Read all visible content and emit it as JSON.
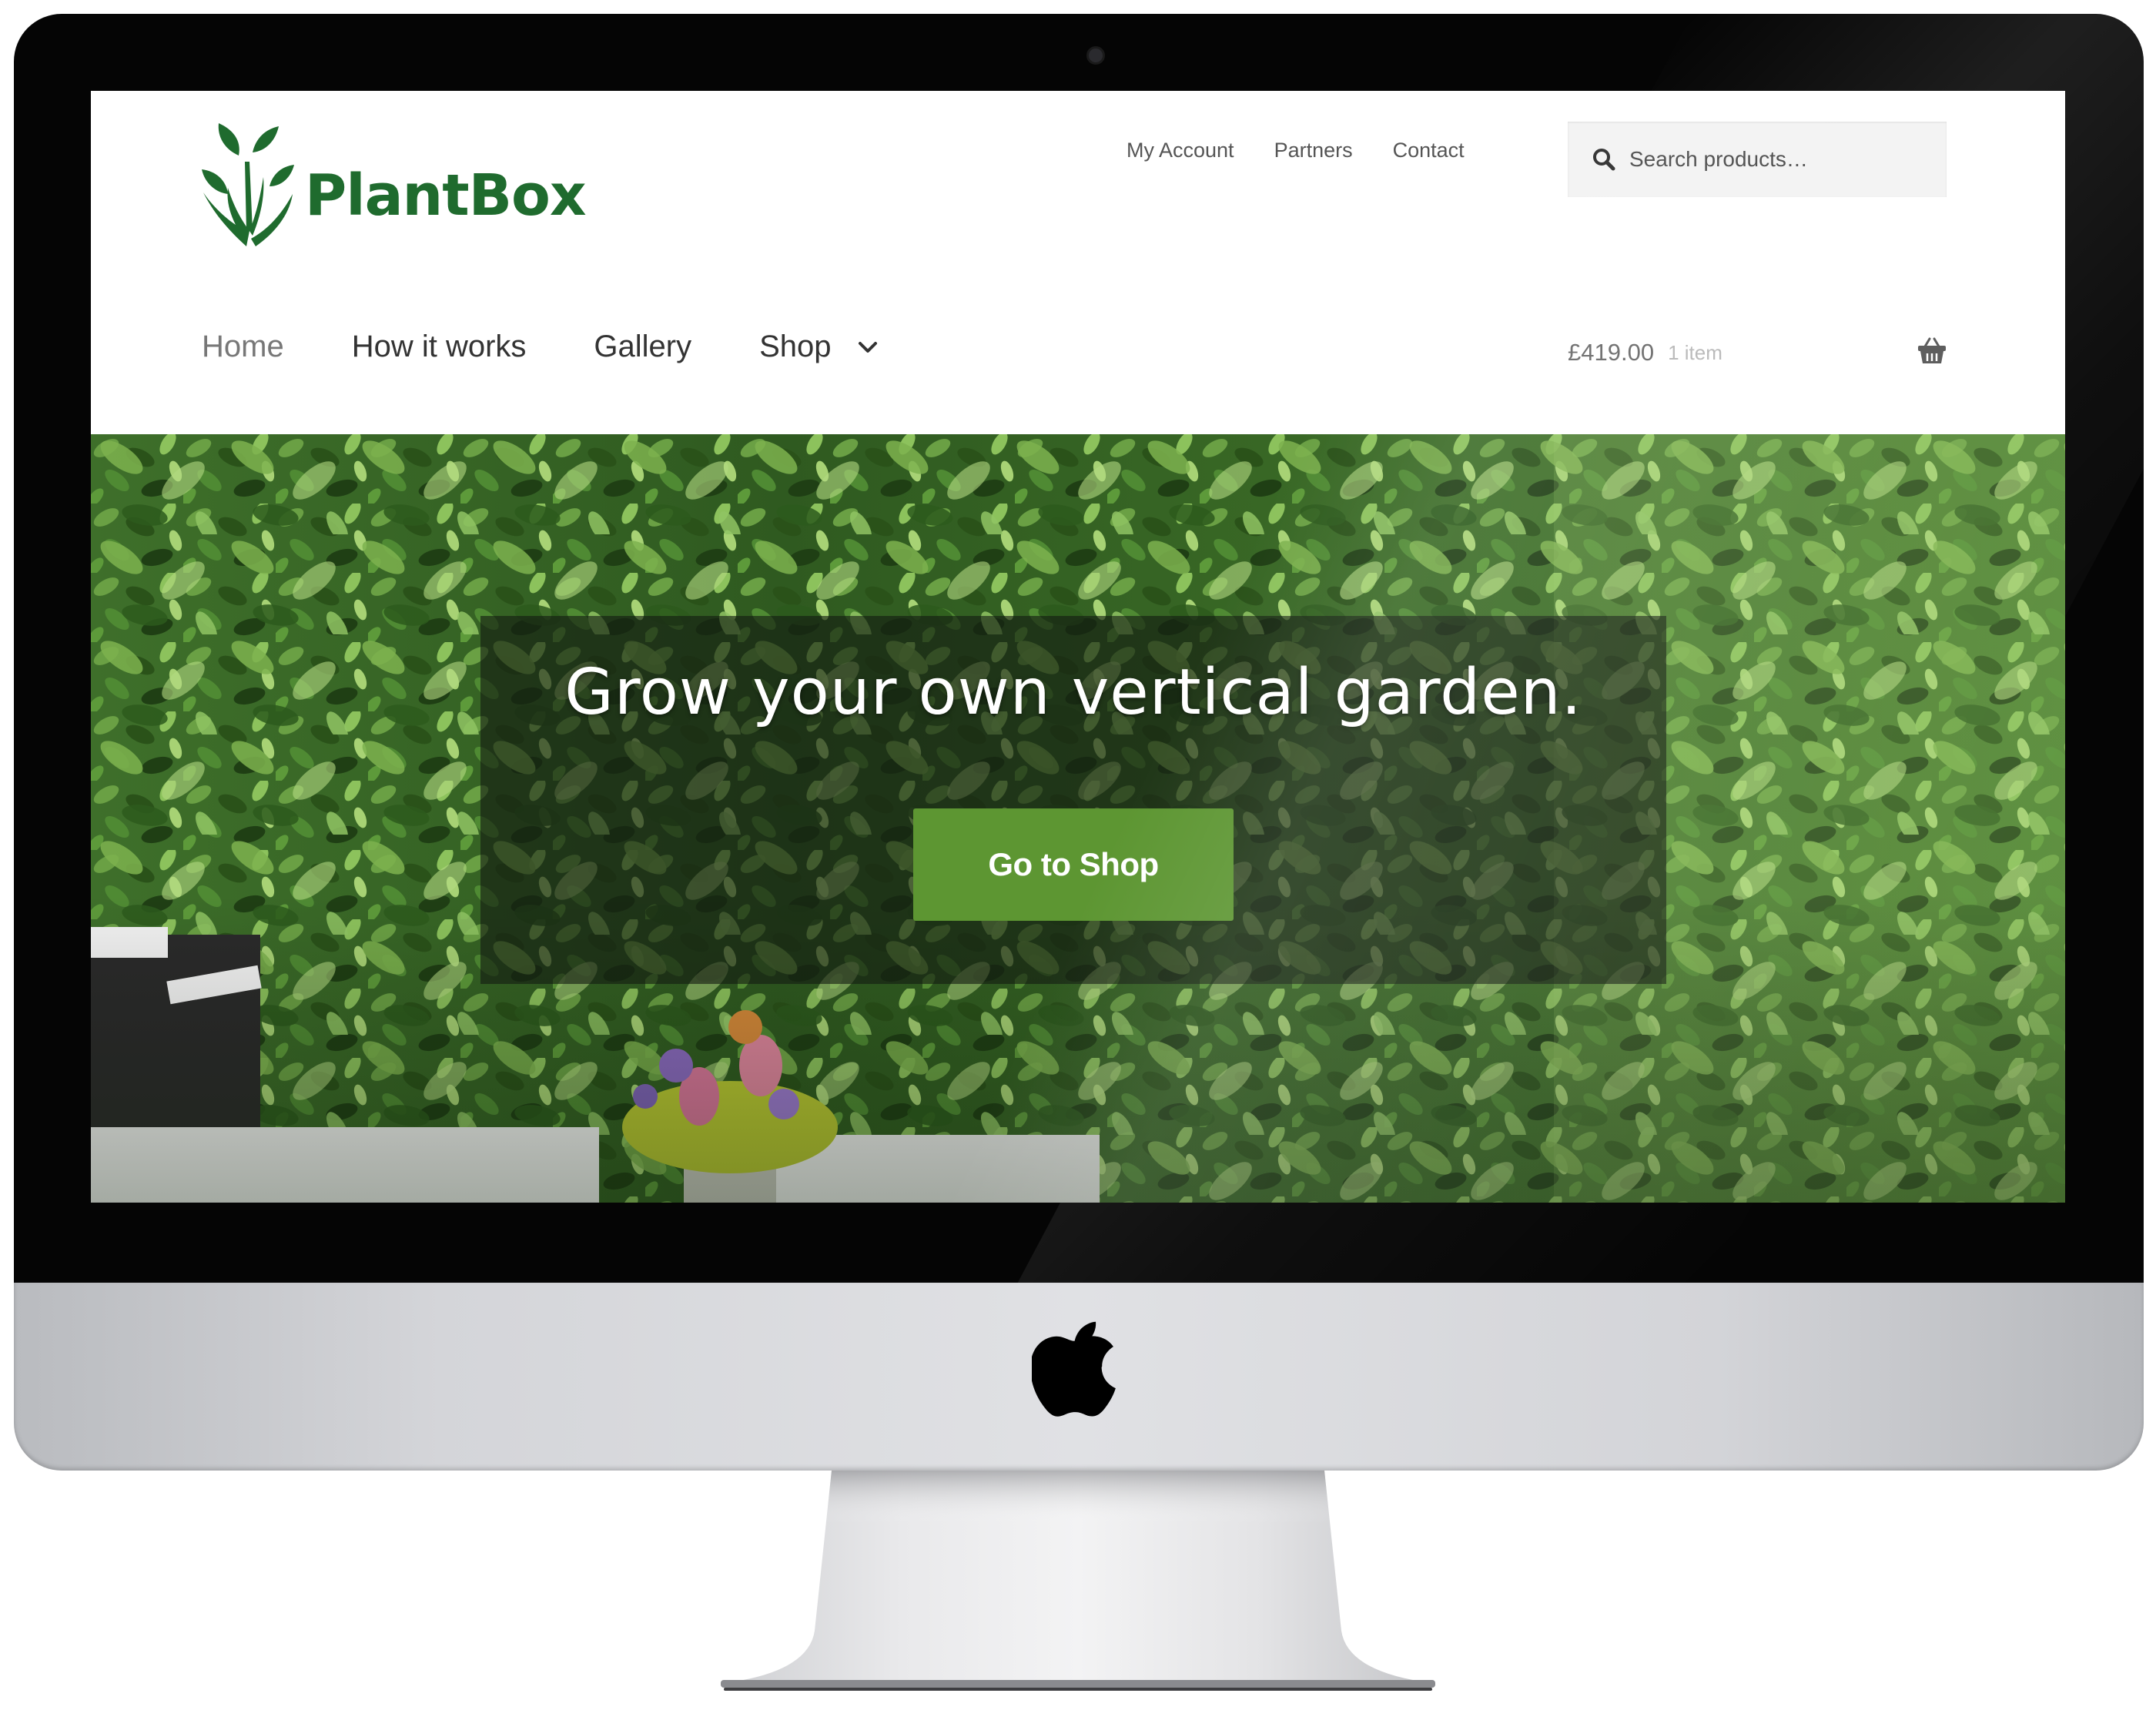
{
  "brand": {
    "name": "PlantBox",
    "color": "#1f6b2e"
  },
  "secondary_nav": {
    "items": [
      "My Account",
      "Partners",
      "Contact"
    ]
  },
  "search": {
    "placeholder": "Search products…",
    "icon": "search-icon"
  },
  "primary_nav": {
    "items": [
      {
        "label": "Home",
        "active": true
      },
      {
        "label": "How it works",
        "active": false
      },
      {
        "label": "Gallery",
        "active": false
      },
      {
        "label": "Shop",
        "active": false,
        "has_dropdown": true
      }
    ]
  },
  "cart": {
    "total": "£419.00",
    "count": "1 item",
    "icon": "basket-icon"
  },
  "hero": {
    "title": "Grow your own vertical garden.",
    "button_label": "Go to Shop",
    "button_color": "#5d9632"
  },
  "device": {
    "type": "iMac",
    "logo": "apple-logo-icon"
  }
}
